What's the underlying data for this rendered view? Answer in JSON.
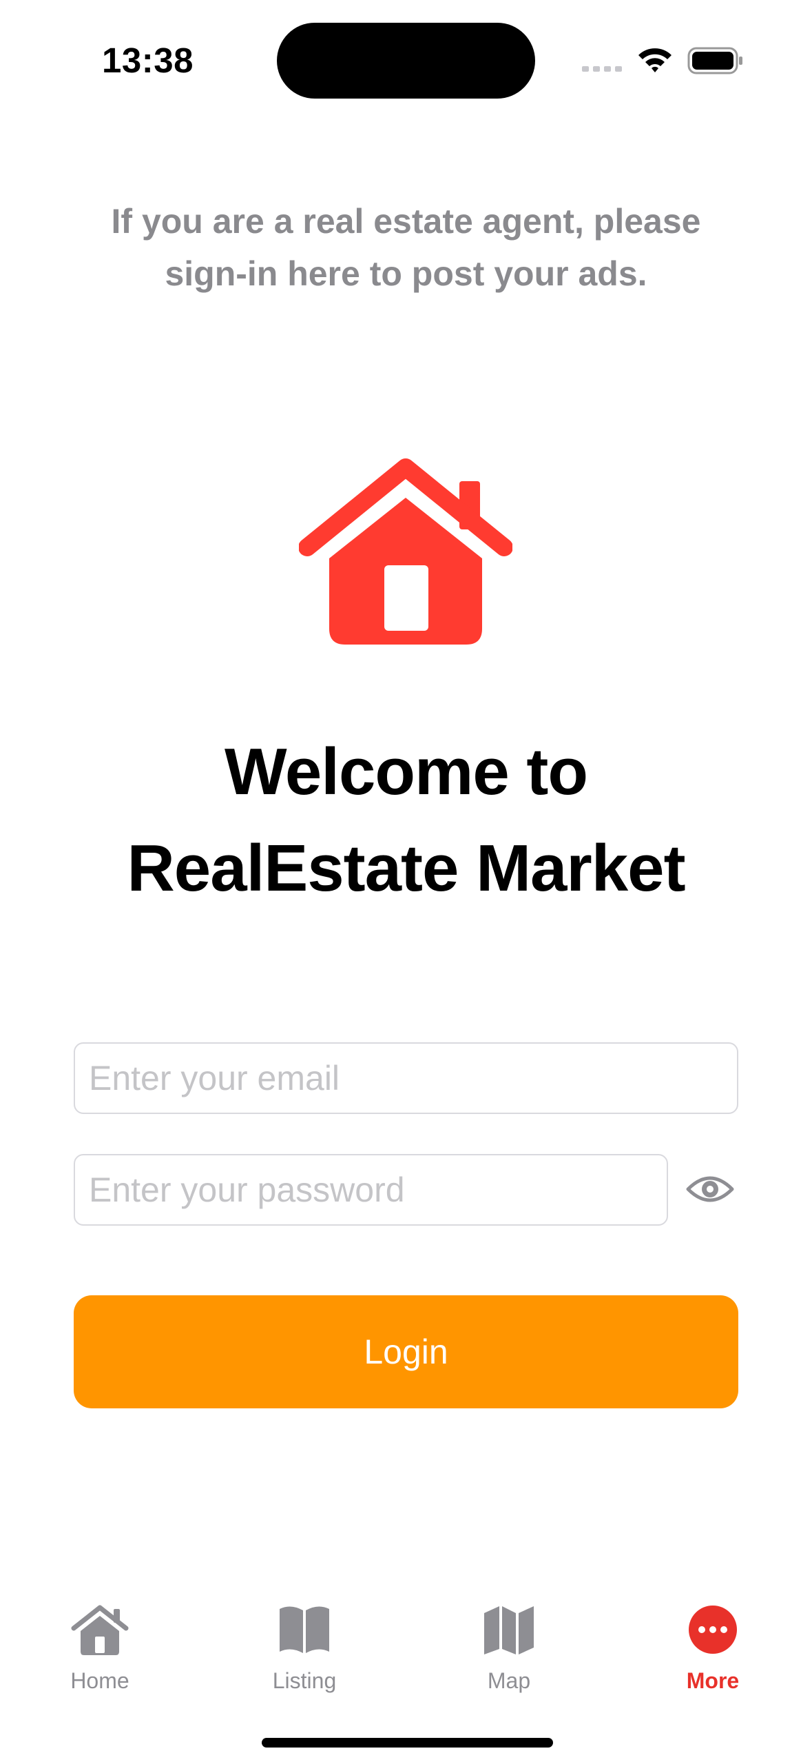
{
  "status_bar": {
    "time": "13:38"
  },
  "notice": {
    "line1": "If you are a real estate agent, please",
    "line2": "sign-in here to post your ads."
  },
  "logo": {
    "icon": "house-icon",
    "color": "#ff3b30"
  },
  "welcome": {
    "line1": "Welcome to",
    "line2": "RealEstate Market"
  },
  "form": {
    "email_placeholder": "Enter your email",
    "email_value": "",
    "password_placeholder": "Enter your password",
    "password_value": "",
    "password_toggle_icon": "eye-icon",
    "login_label": "Login",
    "login_color": "#ff9500"
  },
  "tab_bar": {
    "active_color": "#e8312a",
    "inactive_color": "#8e8e93",
    "items": [
      {
        "label": "Home",
        "icon": "house-icon"
      },
      {
        "label": "Listing",
        "icon": "book-icon"
      },
      {
        "label": "Map",
        "icon": "map-icon"
      },
      {
        "label": "More",
        "icon": "more-icon",
        "active": true
      }
    ]
  }
}
